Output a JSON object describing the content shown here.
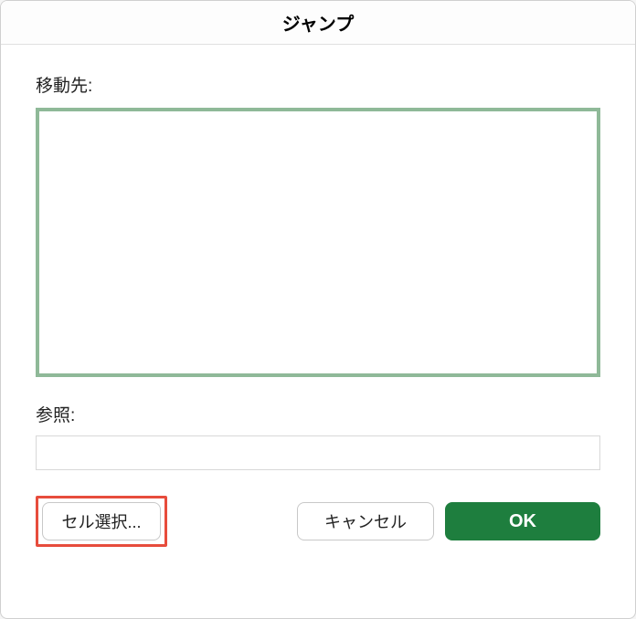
{
  "dialog": {
    "title": "ジャンプ",
    "goto_label": "移動先:",
    "reference_label": "参照:",
    "reference_value": "",
    "listbox_value": ""
  },
  "buttons": {
    "special": "セル選択...",
    "cancel": "キャンセル",
    "ok": "OK"
  },
  "colors": {
    "accent_green": "#1e7e3e",
    "listbox_border": "#8fb998",
    "highlight_red": "#e74c3c"
  }
}
